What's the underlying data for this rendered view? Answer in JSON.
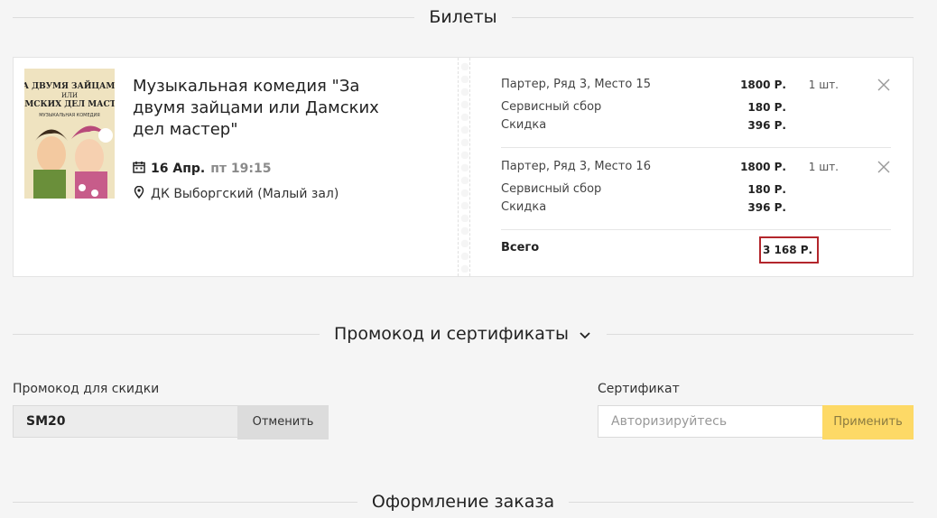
{
  "sections": {
    "tickets": "Билеты",
    "promo": "Промокод и сертификаты",
    "order": "Оформление заказа"
  },
  "event": {
    "title": "Музыкальная комедия \"За двумя зайцами или Дамских дел мастер\"",
    "date": "16 Апр.",
    "time": "пт 19:15",
    "venue": "ДК Выборгский (Малый зал)",
    "poster_lines": [
      "ЗА ДВУМЯ ЗАЙЦАМИ",
      "ИЛИ",
      "ДАМСКИХ ДЕЛ МАСТЕР",
      "МУЗЫКАЛЬНАЯ КОМЕДИЯ"
    ]
  },
  "tickets": [
    {
      "seat": "Партер, Ряд 3, Место 15",
      "price": "1800 Р.",
      "qty": "1 шт.",
      "service_label": "Сервисный сбор",
      "service": "180 Р.",
      "discount_label": "Скидка",
      "discount": "396 Р."
    },
    {
      "seat": "Партер, Ряд 3, Место 16",
      "price": "1800 Р.",
      "qty": "1 шт.",
      "service_label": "Сервисный сбор",
      "service": "180 Р.",
      "discount_label": "Скидка",
      "discount": "396 Р."
    }
  ],
  "total": {
    "label": "Всего",
    "value": "3 168 Р."
  },
  "promo": {
    "label": "Промокод для скидки",
    "value": "SM20",
    "cancel": "Отменить"
  },
  "certificate": {
    "label": "Сертификат",
    "placeholder": "Авторизируйтесь",
    "apply": "Применить"
  },
  "colors": {
    "background": "#f5f5f5",
    "highlight_border": "#b3262c",
    "apply_button": "#fdd966"
  }
}
